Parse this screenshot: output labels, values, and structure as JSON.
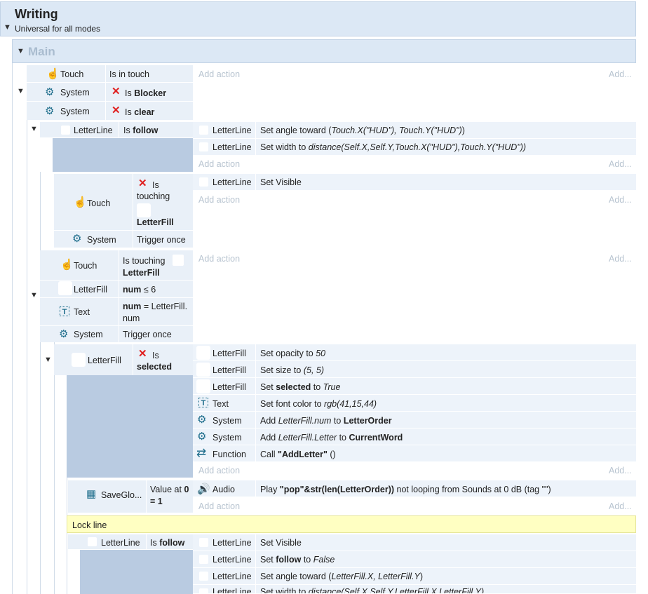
{
  "group": {
    "title": "Writing",
    "subtitle": "Universal for all modes",
    "main": "Main"
  },
  "labels": {
    "add_action": "Add action",
    "add_more": "Add...",
    "touch": "Touch",
    "system": "System",
    "letterline": "LetterLine",
    "letterfill": "LetterFill",
    "text": "Text",
    "function": "Function",
    "audio": "Audio",
    "saveglo": "SaveGlo...",
    "is": "Is",
    "is_in_touch": "Is in touch",
    "blocker": "Blocker",
    "clear": "clear",
    "follow": "follow",
    "touching": "touching",
    "trigger_once": "Trigger once",
    "is_touching": "Is touching",
    "num": "num",
    "le6": "≤ 6",
    "eq_letterfill_num": "= LetterFill.",
    "num2": "num",
    "selected": "selected",
    "value_at": "Value at",
    "zero": "0",
    "eq1": "= 1",
    "comment": "Lock line"
  },
  "actions": {
    "set_angle": "Set angle toward (",
    "set_angle_arg": "Touch.X(\"HUD\"), Touch.Y(\"HUD\")",
    "set_width": "Set width to ",
    "set_width_arg": "distance(Self.X,Self.Y,Touch.X(\"HUD\"),Touch.Y(\"HUD\"))",
    "set_visible": "Set Visible",
    "set_opacity": "Set opacity to ",
    "opacity_val": "50",
    "set_size": "Set size to ",
    "size_val": "(5, 5)",
    "set_word": "Set ",
    "selected": "selected",
    "to": " to ",
    "true_val": "True",
    "false_val": "False",
    "set_font_color": "Set font color to ",
    "rgb": "rgb(41,15,44)",
    "add": "Add ",
    "letterfill_num": "LetterFill.num",
    "letterorder": "LetterOrder",
    "letterfill_letter": "LetterFill.Letter",
    "currentword": "CurrentWord",
    "call": "Call ",
    "addletter": "\"AddLetter\"",
    "paren": " ()",
    "play": "Play ",
    "play_arg": "\"pop\"&str(len(LetterOrder))",
    "play_rest": " not looping from Sounds at 0 dB (tag \"\")",
    "follow": "follow",
    "angle2_arg": "LetterFill.X, LetterFill.Y",
    "width2_arg": "distance(Self.X,Self.Y,LetterFill.X,LetterFill.Y)",
    "close": ")"
  }
}
